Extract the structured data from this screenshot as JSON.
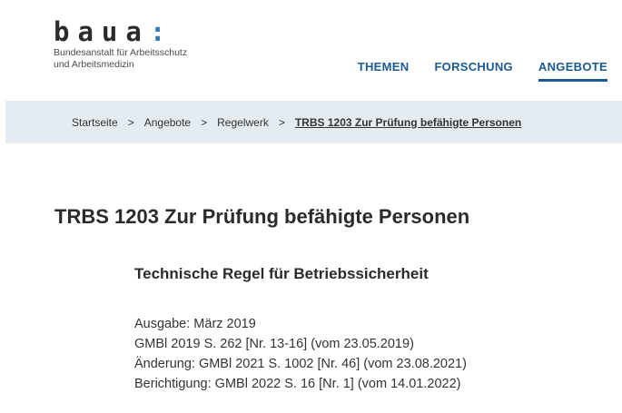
{
  "header": {
    "logo_word": "baua",
    "logo_colon": ":",
    "logo_sub_1": "Bundesanstalt für Arbeitsschutz",
    "logo_sub_2": "und Arbeitsmedizin",
    "nav": [
      {
        "label": "THEMEN",
        "active": false
      },
      {
        "label": "FORSCHUNG",
        "active": false
      },
      {
        "label": "ANGEBOTE",
        "active": true
      }
    ]
  },
  "breadcrumb": {
    "items": [
      "Startseite",
      "Angebote",
      "Regelwerk"
    ],
    "separator": ">",
    "current": "TRBS 1203 Zur Prüfung befähigte Personen"
  },
  "main": {
    "title": "TRBS 1203 Zur Prüfung befähigte Personen",
    "subtitle": "Technische Regel für Betriebssicherheit",
    "details": [
      "Ausgabe: März 2019",
      "GMBl 2019 S. 262 [Nr. 13-16] (vom 23.05.2019)",
      "Änderung: GMBl 2021 S. 1002 [Nr. 46] (vom 23.08.2021)",
      "Berichtigung: GMBl 2022 S. 16 [Nr. 1] (vom 14.01.2022)"
    ]
  },
  "colors": {
    "accent": "#1b5a93",
    "breadcrumb_bg": "#e4ebf1",
    "logo_colon": "#3a7ab8"
  }
}
